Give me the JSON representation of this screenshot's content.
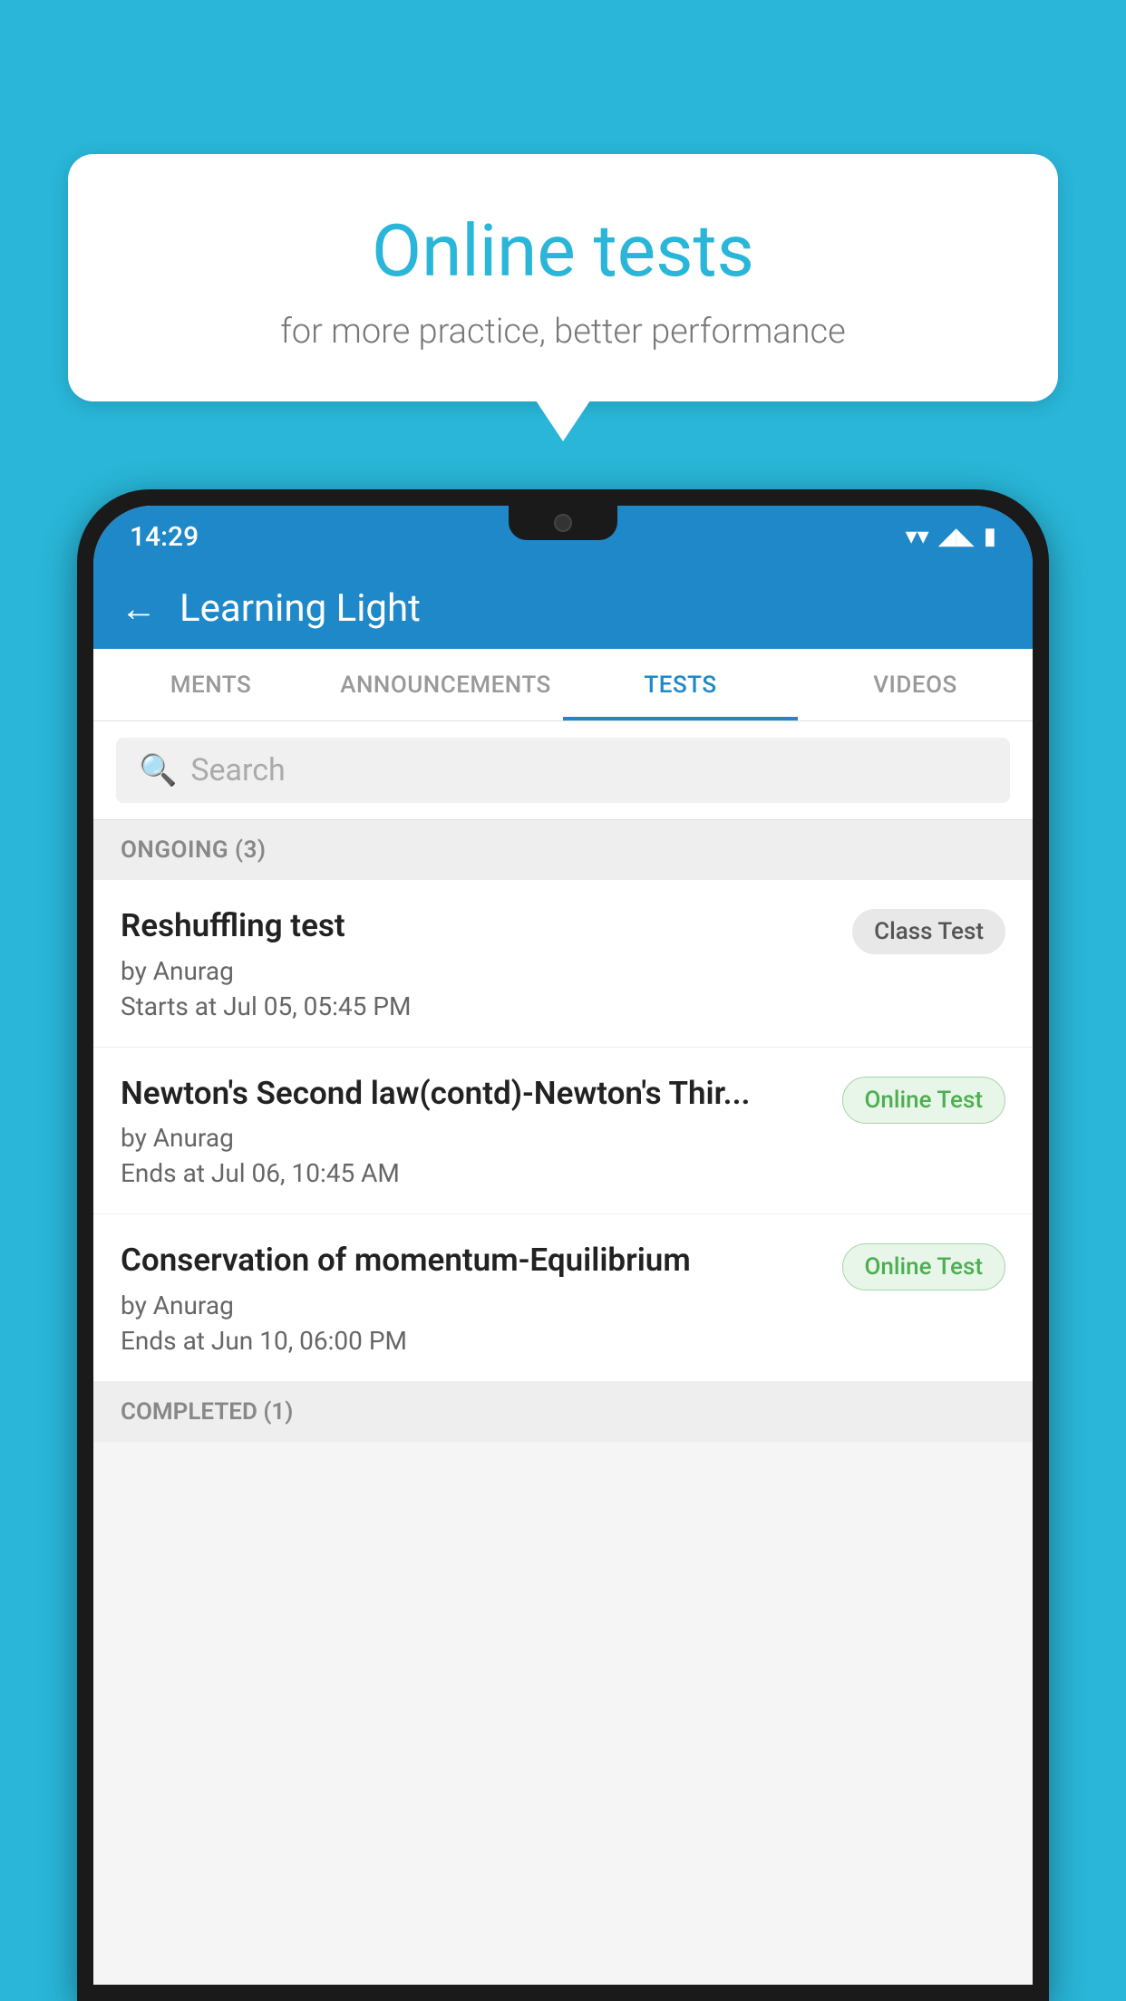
{
  "background": {
    "color": "#29b6d8"
  },
  "speech_bubble": {
    "title": "Online tests",
    "subtitle": "for more practice, better performance"
  },
  "phone": {
    "status_bar": {
      "time": "14:29",
      "wifi": "▼",
      "signal": "▲",
      "battery": "▮"
    },
    "app_bar": {
      "back_label": "←",
      "title": "Learning Light"
    },
    "tabs": [
      {
        "label": "MENTS",
        "active": false
      },
      {
        "label": "ANNOUNCEMENTS",
        "active": false
      },
      {
        "label": "TESTS",
        "active": true
      },
      {
        "label": "VIDEOS",
        "active": false
      }
    ],
    "search": {
      "placeholder": "Search"
    },
    "ongoing_section": {
      "label": "ONGOING (3)",
      "tests": [
        {
          "name": "Reshuffling test",
          "by": "by Anurag",
          "date_label": "Starts at",
          "date": "Jul 05, 05:45 PM",
          "badge": "Class Test",
          "badge_type": "class"
        },
        {
          "name": "Newton's Second law(contd)-Newton's Thir...",
          "by": "by Anurag",
          "date_label": "Ends at",
          "date": "Jul 06, 10:45 AM",
          "badge": "Online Test",
          "badge_type": "online"
        },
        {
          "name": "Conservation of momentum-Equilibrium",
          "by": "by Anurag",
          "date_label": "Ends at",
          "date": "Jun 10, 06:00 PM",
          "badge": "Online Test",
          "badge_type": "online"
        }
      ]
    },
    "completed_section": {
      "label": "COMPLETED (1)"
    }
  }
}
